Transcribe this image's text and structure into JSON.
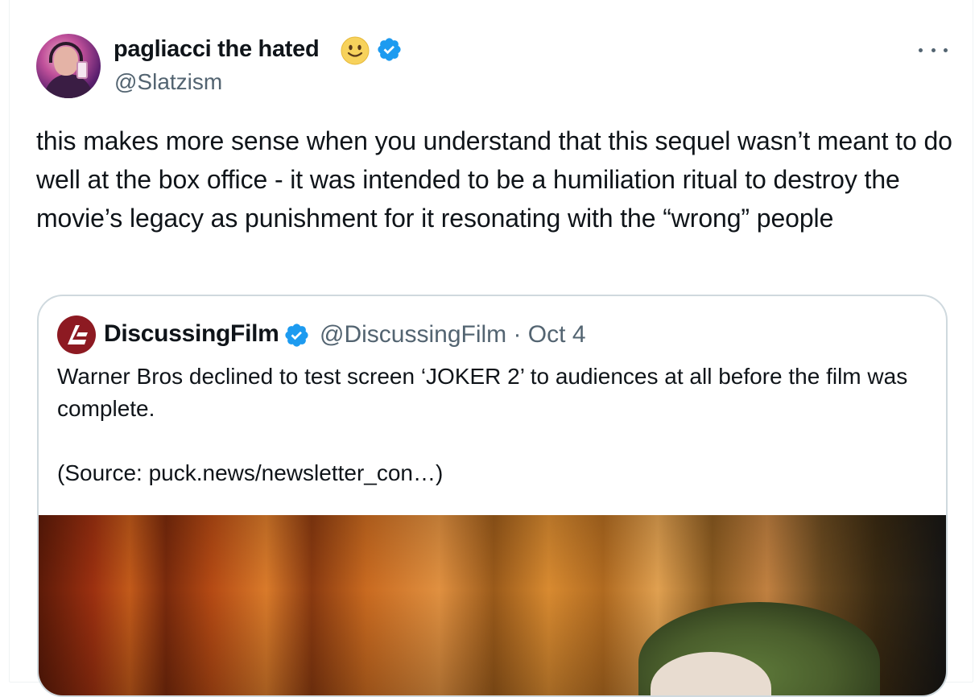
{
  "post": {
    "display_name": "pagliacci the hated",
    "emoji": "slightly-smiling-face",
    "handle": "@Slatzism",
    "text": "this makes more sense when you understand that this sequel wasn’t meant to do well at the box office - it was intended to be a humiliation ritual to destroy the movie’s legacy as punishment for it resonating with the “wrong” people"
  },
  "quote": {
    "display_name": "DiscussingFilm",
    "handle_date": "@DiscussingFilm · Oct 4",
    "text_line1": "Warner Bros declined to test screen ‘JOKER 2’ to audiences at all before the film was complete.",
    "text_line2": "(Source: puck.news/newsletter_con…)"
  },
  "icons": {
    "verified": "verified-badge-icon",
    "more": "more-options-icon"
  },
  "colors": {
    "verified_blue": "#1d9bf0",
    "secondary_text": "#536471",
    "border": "#cfd9de",
    "discussingfilm_red": "#8d1a22"
  }
}
